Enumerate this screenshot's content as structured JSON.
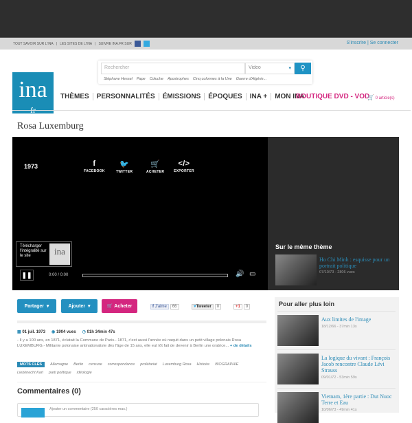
{
  "utility": {
    "links": [
      "TOUT SAVOIR SUR L'INA",
      "LES SITES DE L'INA",
      "SUIVRE INA.FR SUR"
    ],
    "signup": "S'inscrire",
    "login": "Se connecter"
  },
  "search": {
    "placeholder": "Rechercher",
    "type": "Video",
    "suggestions": [
      "Stéphane Hessel",
      "Pape",
      "Coluche",
      "Apostrophes",
      "Cinq colonnes à la Une",
      "Guerre d'Algérie..."
    ]
  },
  "logo": {
    "main": "ina",
    "sub": "fr"
  },
  "nav": [
    "THÈMES",
    "PERSONNALITÉS",
    "ÉMISSIONS",
    "ÉPOQUES",
    "INA +",
    "MON INA"
  ],
  "boutique": "BOUTIQUE DVD - VOD",
  "cart": "0 article(s)",
  "title": "Rosa Luxemburg",
  "player": {
    "year": "1973",
    "share": [
      {
        "icon": "f",
        "label": "FACEBOOK"
      },
      {
        "icon": "🐦",
        "label": "TWITTER"
      },
      {
        "icon": "🛒",
        "label": "ACHETER"
      },
      {
        "icon": "</>",
        "label": "EXPORTER"
      }
    ],
    "download": "Télécharger l'intégralité sur le site",
    "download_logo": "ina",
    "time": "0:00  /  0:00",
    "progress": 0
  },
  "theme": {
    "heading": "Sur le même thème",
    "item": {
      "title": "Ho Chi Minh : esquisse pour un portrait politique",
      "meta": "07/10/73 - 2806 vues"
    }
  },
  "actions": {
    "share": "Partager",
    "add": "Ajouter",
    "buy": "Acheter",
    "fb": "J'aime",
    "fb_count": "66",
    "tw": "Tweeter",
    "tw_count": "0",
    "gp": "+1",
    "gp_count": "0"
  },
  "stats": {
    "date": "01 juil. 1973",
    "views": "1904 vues",
    "duration": "01h 34min 47s"
  },
  "description": "- Il y a 100 ans, en 1871, éclatait la Commune de Paris.- 1871, c'est aussi l'année où naquit dans un petit village polonais Rosa LUXEMBURG.- Militante polonaise antinationaliste dès l'âge de 15 ans, elle eut tôt fait de devenir à Berlin une oratrice...",
  "more": "+ de détails",
  "tags_label": "MOTS CLÉS",
  "tags": [
    "Allemagne",
    "Berlin",
    "censure",
    "correspondance",
    "prolétariat",
    "Luxemburg Rosa",
    "Histoire",
    "BIOGRAPHIE",
    "Liebknecht Karl",
    "parti politique",
    "idéologie"
  ],
  "comments": {
    "heading": "Commentaires (0)",
    "placeholder": "Ajouter un commentaire (250 caractères max.)"
  },
  "further": {
    "heading": "Pour aller plus loin",
    "items": [
      {
        "title": "Aux limites de l'image",
        "meta": "18/12/66 - 37min 13s"
      },
      {
        "title": "La logique du vivant : François Jacob rencontre Claude Lévi Strauss",
        "meta": "09/01/72 - 53min 59s"
      },
      {
        "title": "Vietnam, 1ère partie : Dut Nuoc Terre et Eau",
        "meta": "10/06/73 - 49min 41s"
      }
    ]
  },
  "colors": {
    "accent": "#2a8ab5",
    "brand": "#1a8db6",
    "pink": "#d4267f"
  }
}
